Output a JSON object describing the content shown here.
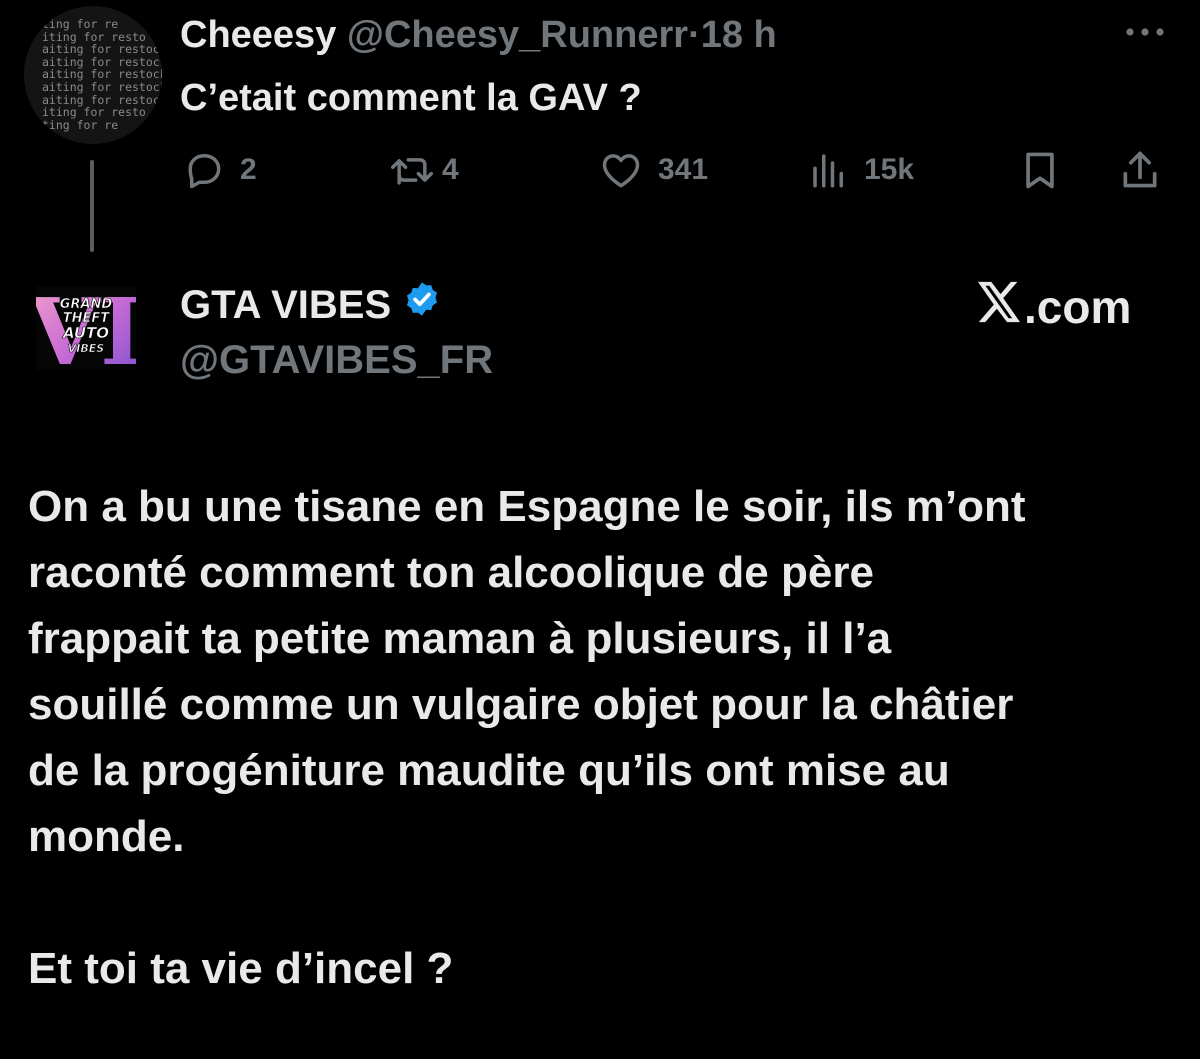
{
  "reply_tweet": {
    "avatar_ascii_lines": [
      "ting for re",
      "iting for resto",
      "aiting for restoc",
      "aiting for restock",
      "aiting for restock",
      "aiting for restock",
      "aiting for restoc",
      "iting for resto",
      "ting for re"
    ],
    "display_name": "Cheeesy",
    "handle": "@Cheesy_Runnerr",
    "separator": "·",
    "time": "18 h",
    "more_icon": "more-dots-icon",
    "text": "C’etait comment la GAV ?",
    "actions": {
      "reply": {
        "icon": "reply-icon",
        "count": "2"
      },
      "repost": {
        "icon": "repost-icon",
        "count": "4"
      },
      "like": {
        "icon": "heart-icon",
        "count": "341"
      },
      "views": {
        "icon": "views-icon",
        "count": "15k"
      },
      "bookmark": {
        "icon": "bookmark-icon"
      },
      "share": {
        "icon": "share-icon"
      }
    }
  },
  "main_tweet": {
    "display_name": "GTA VIBES",
    "verified_icon": "verified-badge-icon",
    "handle": "@GTAVIBES_FR",
    "avatar_logo_lines": [
      "GRAND",
      "THEFT",
      "AUTO",
      "VIBES"
    ],
    "avatar_logo_mark": "VI",
    "site_logo_icon": "x-logo-icon",
    "site_label": ".com",
    "text_lines": [
      "On a bu une tisane en Espagne le soir, ils m’ont",
      "raconté comment ton alcoolique de père",
      "frappait ta petite maman à plusieurs, il l’a",
      "souillé comme un vulgaire objet pour la châtier",
      "de la progéniture maudite qu’ils ont mise au",
      "monde."
    ],
    "text_last": "Et toi ta vie d’incel ?"
  },
  "colors": {
    "background": "#000000",
    "text": "#e7e9ea",
    "muted": "#71767b",
    "verified": "#1d9bf0"
  }
}
